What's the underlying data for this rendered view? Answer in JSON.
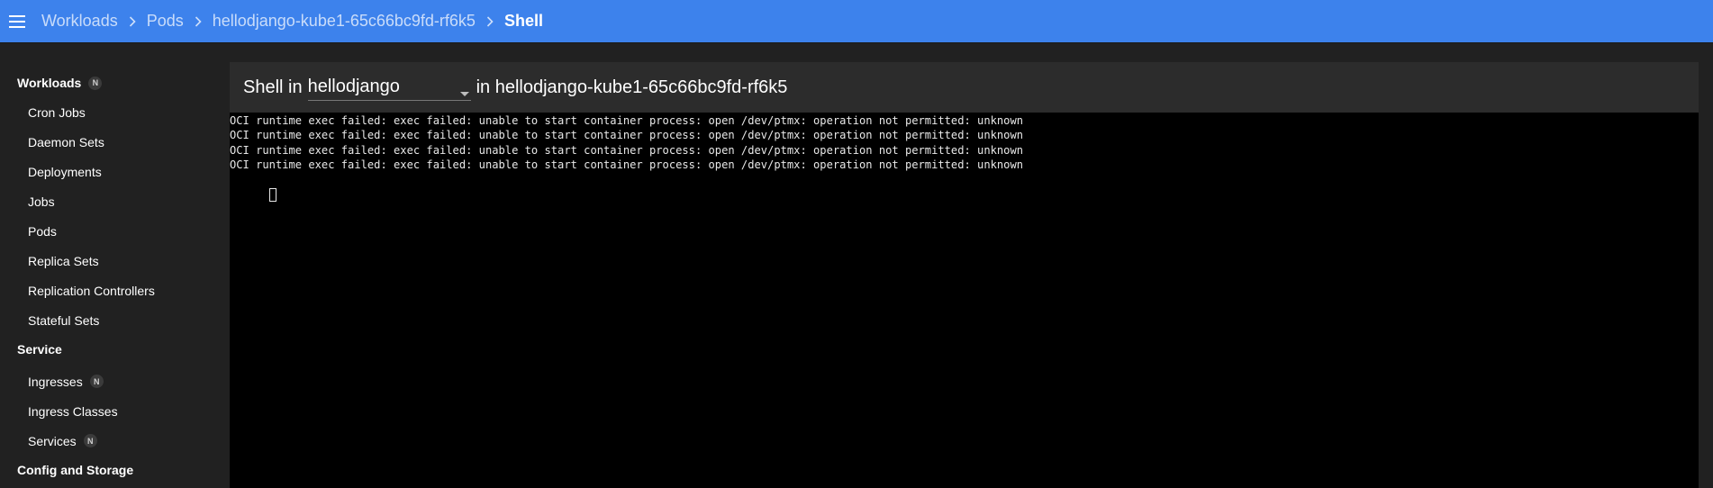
{
  "topbar": {
    "menu_icon": "hamburger-menu-icon",
    "breadcrumbs": [
      "Workloads",
      "Pods",
      "hellodjango-kube1-65c66bc9fd-rf6k5",
      "Shell"
    ]
  },
  "sidebar": {
    "sections": [
      {
        "title": "Workloads",
        "badge": "N",
        "items": [
          {
            "label": "Cron Jobs"
          },
          {
            "label": "Daemon Sets"
          },
          {
            "label": "Deployments"
          },
          {
            "label": "Jobs"
          },
          {
            "label": "Pods"
          },
          {
            "label": "Replica Sets"
          },
          {
            "label": "Replication Controllers"
          },
          {
            "label": "Stateful Sets"
          }
        ]
      },
      {
        "title": "Service",
        "items": [
          {
            "label": "Ingresses",
            "badge": "N"
          },
          {
            "label": "Ingress Classes"
          },
          {
            "label": "Services",
            "badge": "N"
          }
        ]
      },
      {
        "title": "Config and Storage",
        "items": []
      }
    ]
  },
  "main": {
    "shell_label": "Shell in",
    "container_select": {
      "value": "hellodjango"
    },
    "in_label": "in hellodjango-kube1-65c66bc9fd-rf6k5",
    "terminal_lines": [
      "OCI runtime exec failed: exec failed: unable to start container process: open /dev/ptmx: operation not permitted: unknown",
      "OCI runtime exec failed: exec failed: unable to start container process: open /dev/ptmx: operation not permitted: unknown",
      "OCI runtime exec failed: exec failed: unable to start container process: open /dev/ptmx: operation not permitted: unknown",
      "OCI runtime exec failed: exec failed: unable to start container process: open /dev/ptmx: operation not permitted: unknown"
    ]
  },
  "colors": {
    "topbar": "#3d82ec",
    "background": "#212121",
    "header_card": "#2c2c2c",
    "terminal": "#000000"
  }
}
